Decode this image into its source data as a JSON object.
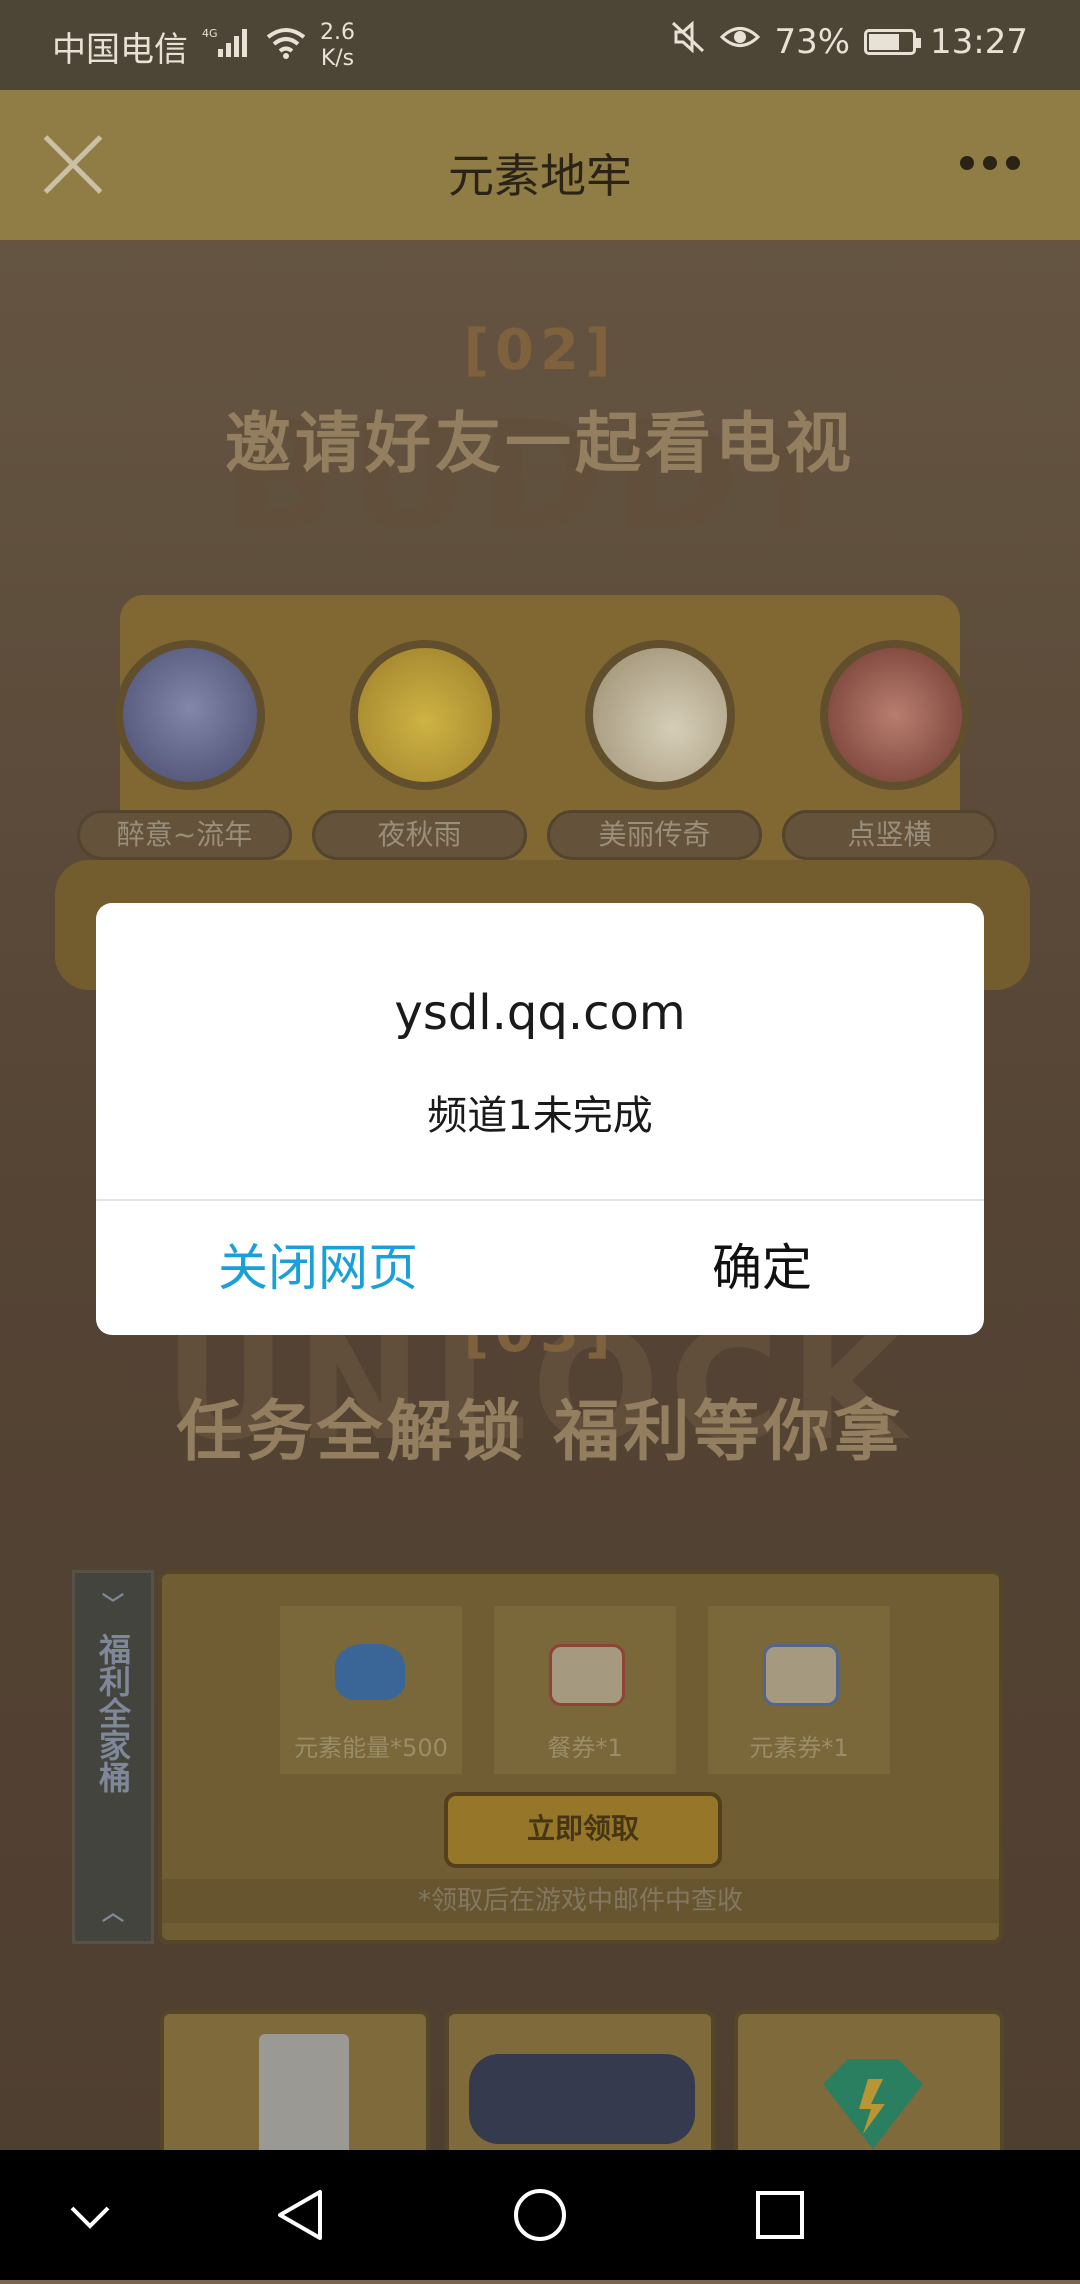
{
  "status_bar": {
    "carrier": "中国电信",
    "network": "4G",
    "speed_value": "2.6",
    "speed_unit": "K/s",
    "battery": "73%",
    "time": "13:27"
  },
  "title_bar": {
    "title": "元素地牢"
  },
  "section_invite": {
    "number": "[02]",
    "title": "邀请好友一起看电视",
    "ghost_text": "BUDDY",
    "friends": [
      "醉意~流年",
      "夜秋雨",
      "美丽传奇",
      "点竖横"
    ]
  },
  "section_unlock": {
    "number": "[03]",
    "title": "任务全解锁  福利等你拿",
    "ghost_text": "UNLOCK"
  },
  "rewards": {
    "side_tab": "福利全家桶",
    "items": [
      "元素能量*500",
      "餐券*1",
      "元素券*1"
    ],
    "claim_button": "立即领取",
    "note": "*领取后在游戏中邮件中查收"
  },
  "dialog": {
    "host": "ysdl.qq.com",
    "message": "频道1未完成",
    "cancel": "关闭网页",
    "ok": "确定",
    "cancel_color": "#1aa0d8"
  },
  "nav_icons": [
    "chevron-down-icon",
    "back-icon",
    "home-icon",
    "recents-icon"
  ]
}
